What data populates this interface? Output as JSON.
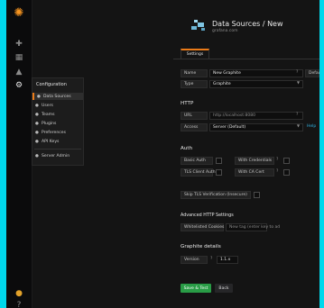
{
  "page": {
    "title": "Data Sources / New",
    "subtitle": "grafana.com"
  },
  "tabs": [
    {
      "label": "Settings"
    }
  ],
  "fields": {
    "name": {
      "label": "Name",
      "value": "New Graphite"
    },
    "default": {
      "label": "Default"
    },
    "type": {
      "label": "Type",
      "value": "Graphite"
    }
  },
  "http": {
    "heading": "HTTP",
    "url": {
      "label": "URL",
      "placeholder": "http://localhost:8080"
    },
    "access": {
      "label": "Access",
      "value": "Server (Default)",
      "help_label": "Help"
    }
  },
  "auth": {
    "heading": "Auth",
    "basic_auth": "Basic Auth",
    "with_credentials": "With Credentials",
    "tls_client_auth": "TLS Client Auth",
    "with_ca_cert": "With CA Cert",
    "skip_tls_verify": "Skip TLS Verification (Insecure)"
  },
  "cookies": {
    "heading": "Advanced HTTP Settings",
    "whitelisted_label": "Whitelisted Cookies",
    "placeholder": "New tag (enter key to ad"
  },
  "graphite": {
    "heading": "Graphite details",
    "version_label": "Version",
    "version_value": "1.1.x"
  },
  "buttons": {
    "save": "Save & Test",
    "back": "Back"
  },
  "dropdown": {
    "header": "Configuration",
    "items": [
      {
        "label": "Data Sources",
        "icon": "database-icon",
        "active": true
      },
      {
        "label": "Users"
      },
      {
        "label": "Teams"
      },
      {
        "label": "Plugins"
      },
      {
        "label": "Preferences"
      },
      {
        "label": "API Keys"
      },
      {
        "label": "Server Admin"
      }
    ]
  },
  "colors": {
    "accent": "#eb7b18",
    "save_button": "#299c46",
    "frame_border": "#00d8ec"
  }
}
